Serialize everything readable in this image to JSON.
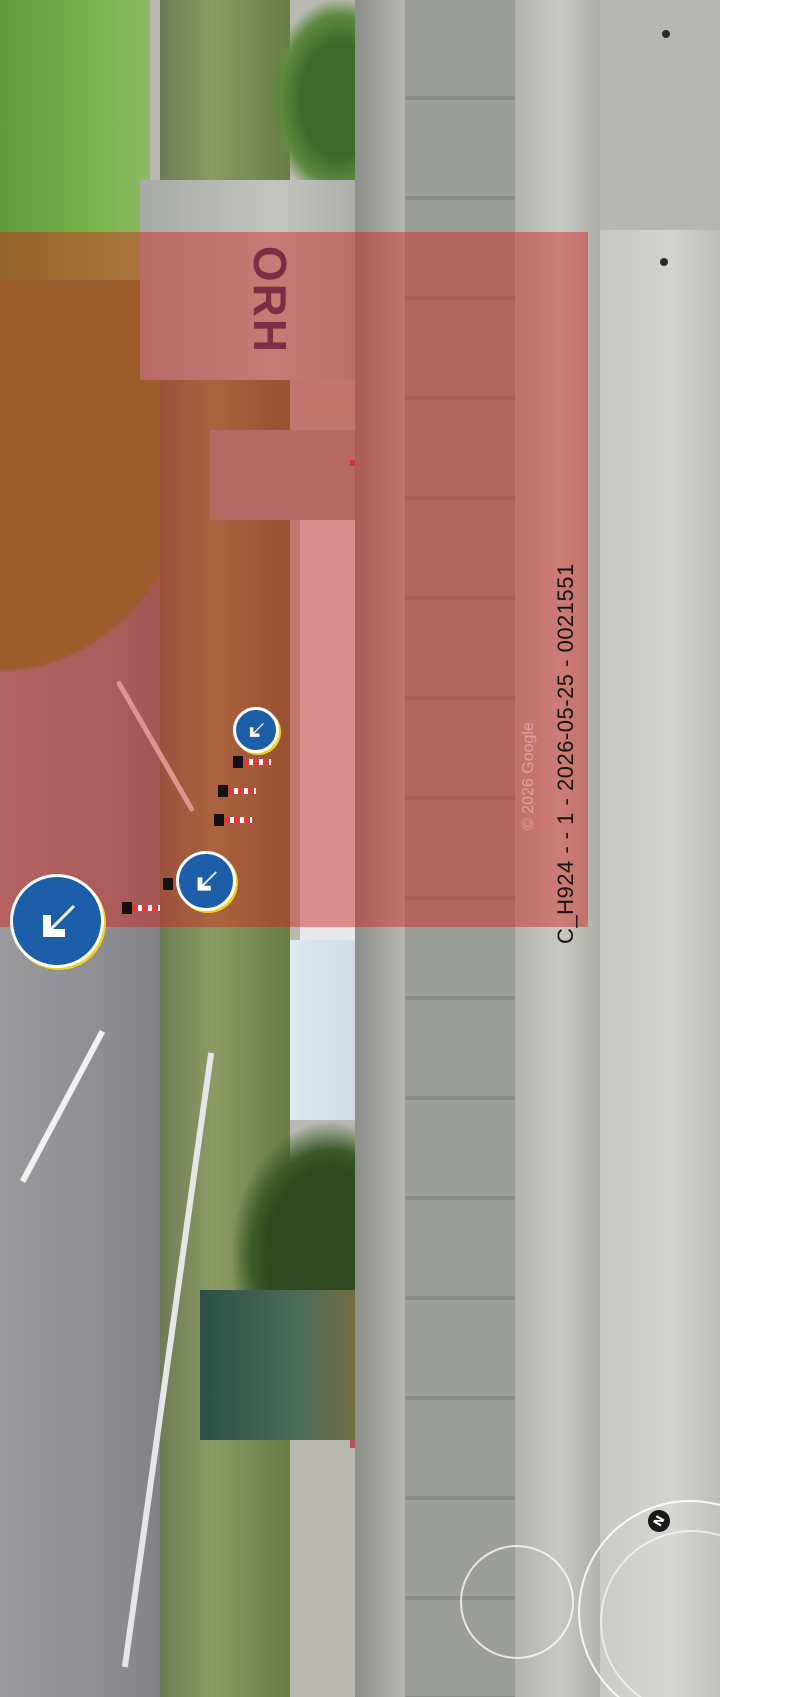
{
  "caption": {
    "text": "C_H924 -  - 1 - 2026-05-25 - 0021551"
  },
  "graffiti": {
    "text": "ORH"
  },
  "overlay": {
    "color": "#d21e19",
    "opacity": 0.45
  },
  "compass": {
    "north_label": "N"
  },
  "signs": [
    {
      "type": "keep-left-sign"
    },
    {
      "type": "keep-left-sign"
    },
    {
      "type": "keep-left-sign"
    }
  ],
  "cones": [
    {
      "type": "traffic-cone"
    },
    {
      "type": "traffic-cone"
    },
    {
      "type": "traffic-cone"
    },
    {
      "type": "traffic-cone"
    },
    {
      "type": "traffic-cone"
    }
  ]
}
